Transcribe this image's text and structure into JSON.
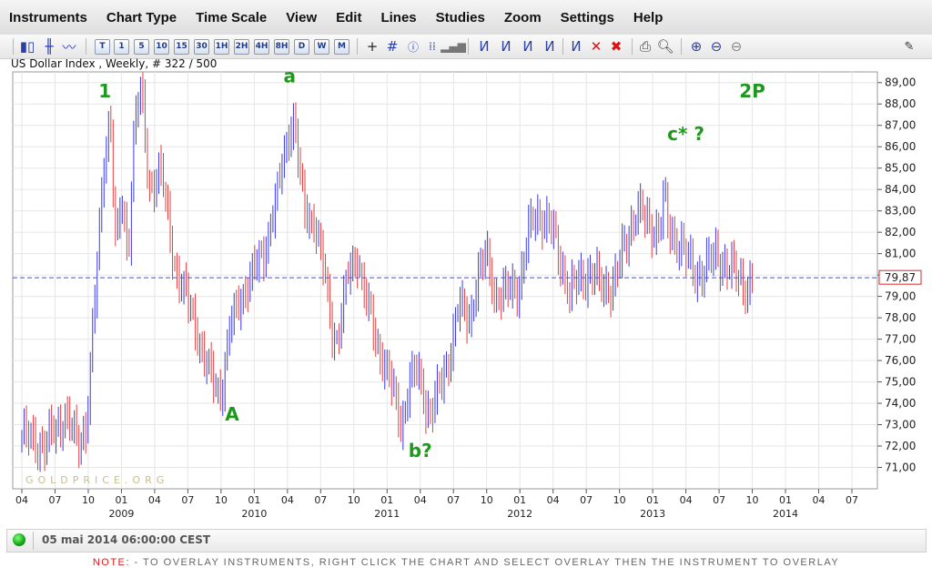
{
  "menu": [
    "Instruments",
    "Chart Type",
    "Time Scale",
    "View",
    "Edit",
    "Lines",
    "Studies",
    "Zoom",
    "Settings",
    "Help"
  ],
  "toolbar": {
    "timeframes": [
      "T",
      "1",
      "5",
      "10",
      "15",
      "30",
      "1H",
      "2H",
      "4H",
      "8H",
      "D",
      "W",
      "M"
    ]
  },
  "chart_header": "US Dollar Index , Weekly, # 322 / 500",
  "watermark": "GOLDPRICE.ORG",
  "status": {
    "timestamp": "05 mai 2014 06:00:00 CEST"
  },
  "note": {
    "prefix": "NOTE:",
    "text": " - TO OVERLAY INSTRUMENTS, RIGHT CLICK THE CHART AND SELECT OVERLAY THEN THE INSTRUMENT TO OVERLAY"
  },
  "colors": {
    "up": "#3a3ae6",
    "down": "#e04040",
    "wave_label": "#1d9a1d",
    "dashed": "#4a4adf",
    "price_tag": "#d62828"
  },
  "chart_data": {
    "type": "ohlc",
    "title": "US Dollar Index , Weekly",
    "ylim": [
      70,
      89.5
    ],
    "y_ticks": [
      "71,00",
      "72,00",
      "73,00",
      "74,00",
      "75,00",
      "76,00",
      "77,00",
      "78,00",
      "79,00",
      "80,00",
      "81,00",
      "82,00",
      "83,00",
      "84,00",
      "85,00",
      "86,00",
      "87,00",
      "88,00",
      "89,00"
    ],
    "x_axis_start": "2008-04",
    "x_axis_end": "2014-07",
    "x_ticks": [
      {
        "label": "04",
        "t": 0
      },
      {
        "label": "07",
        "t": 3
      },
      {
        "label": "10",
        "t": 6
      },
      {
        "label": "01",
        "t": 9
      },
      {
        "label": "04",
        "t": 12
      },
      {
        "label": "07",
        "t": 15
      },
      {
        "label": "10",
        "t": 18
      },
      {
        "label": "01",
        "t": 21
      },
      {
        "label": "04",
        "t": 24
      },
      {
        "label": "07",
        "t": 27
      },
      {
        "label": "10",
        "t": 30
      },
      {
        "label": "01",
        "t": 33
      },
      {
        "label": "04",
        "t": 36
      },
      {
        "label": "07",
        "t": 39
      },
      {
        "label": "10",
        "t": 42
      },
      {
        "label": "01",
        "t": 45
      },
      {
        "label": "04",
        "t": 48
      },
      {
        "label": "07",
        "t": 51
      },
      {
        "label": "10",
        "t": 54
      },
      {
        "label": "01",
        "t": 57
      },
      {
        "label": "04",
        "t": 60
      },
      {
        "label": "07",
        "t": 63
      },
      {
        "label": "10",
        "t": 66
      },
      {
        "label": "01",
        "t": 69
      },
      {
        "label": "04",
        "t": 72
      },
      {
        "label": "07",
        "t": 75
      }
    ],
    "year_labels": [
      {
        "label": "2009",
        "t": 9
      },
      {
        "label": "2010",
        "t": 21
      },
      {
        "label": "2011",
        "t": 33
      },
      {
        "label": "2012",
        "t": 45
      },
      {
        "label": "2013",
        "t": 57
      },
      {
        "label": "2014",
        "t": 69
      }
    ],
    "current_price": 79.87,
    "current_price_label": "79,87",
    "path_anchors": [
      [
        0,
        72.5
      ],
      [
        2,
        72.0
      ],
      [
        4,
        73.5
      ],
      [
        5,
        72.0
      ],
      [
        5.8,
        73.0
      ],
      [
        6.5,
        78.0
      ],
      [
        7.5,
        86.0
      ],
      [
        8.0,
        87.5
      ],
      [
        8.5,
        81.0
      ],
      [
        9.0,
        83.5
      ],
      [
        9.6,
        81.0
      ],
      [
        10.2,
        87.5
      ],
      [
        10.8,
        88.5
      ],
      [
        11.5,
        84.0
      ],
      [
        12.5,
        85.0
      ],
      [
        13.8,
        80.5
      ],
      [
        14.8,
        79.0
      ],
      [
        15.8,
        77.5
      ],
      [
        16.5,
        76.0
      ],
      [
        17.3,
        75.0
      ],
      [
        18.0,
        74.5
      ],
      [
        18.8,
        77.5
      ],
      [
        19.8,
        79.0
      ],
      [
        20.8,
        80.0
      ],
      [
        21.8,
        81.0
      ],
      [
        23.0,
        83.5
      ],
      [
        23.8,
        86.0
      ],
      [
        24.5,
        87.5
      ],
      [
        25.5,
        83.0
      ],
      [
        26.5,
        82.5
      ],
      [
        27.5,
        79.5
      ],
      [
        28.0,
        77.5
      ],
      [
        28.5,
        77.0
      ],
      [
        29.5,
        80.0
      ],
      [
        30.3,
        81.0
      ],
      [
        31.0,
        79.0
      ],
      [
        32.0,
        77.0
      ],
      [
        33.0,
        75.5
      ],
      [
        33.8,
        74.0
      ],
      [
        34.3,
        73.0
      ],
      [
        35.0,
        75.0
      ],
      [
        35.8,
        75.5
      ],
      [
        36.5,
        74.0
      ],
      [
        37.0,
        73.5
      ],
      [
        38.5,
        76.0
      ],
      [
        39.5,
        78.5
      ],
      [
        40.5,
        78.0
      ],
      [
        41.0,
        79.5
      ],
      [
        42.0,
        81.0
      ],
      [
        42.8,
        79.0
      ],
      [
        43.5,
        79.0
      ],
      [
        44.3,
        79.5
      ],
      [
        45.0,
        79.5
      ],
      [
        45.8,
        82.0
      ],
      [
        46.5,
        83.0
      ],
      [
        47.2,
        82.5
      ],
      [
        48.0,
        82.0
      ],
      [
        48.8,
        80.5
      ],
      [
        49.5,
        79.0
      ],
      [
        50.5,
        80.0
      ],
      [
        51.5,
        80.0
      ],
      [
        52.5,
        79.5
      ],
      [
        53.5,
        79.5
      ],
      [
        54.5,
        81.5
      ],
      [
        55.5,
        83.0
      ],
      [
        56.5,
        82.5
      ],
      [
        57.5,
        82.0
      ],
      [
        58.0,
        83.5
      ],
      [
        58.5,
        82.0
      ],
      [
        59.5,
        81.5
      ],
      [
        60.3,
        80.5
      ],
      [
        61.0,
        80.0
      ],
      [
        62.0,
        80.5
      ],
      [
        62.8,
        81.0
      ],
      [
        63.5,
        80.5
      ],
      [
        64.5,
        80.0
      ],
      [
        65.5,
        79.5
      ],
      [
        66.0,
        79.5
      ]
    ],
    "wave_labels": [
      {
        "label": "1",
        "t": 7.5,
        "y": 88.3
      },
      {
        "label": "a",
        "t": 24.2,
        "y": 89.0
      },
      {
        "label": "A",
        "t": 19.0,
        "y": 73.2
      },
      {
        "label": "b?",
        "t": 36.0,
        "y": 71.5
      },
      {
        "label": "c* ?",
        "t": 60.0,
        "y": 86.3
      },
      {
        "label": "2P",
        "t": 66.0,
        "y": 88.3
      }
    ]
  }
}
